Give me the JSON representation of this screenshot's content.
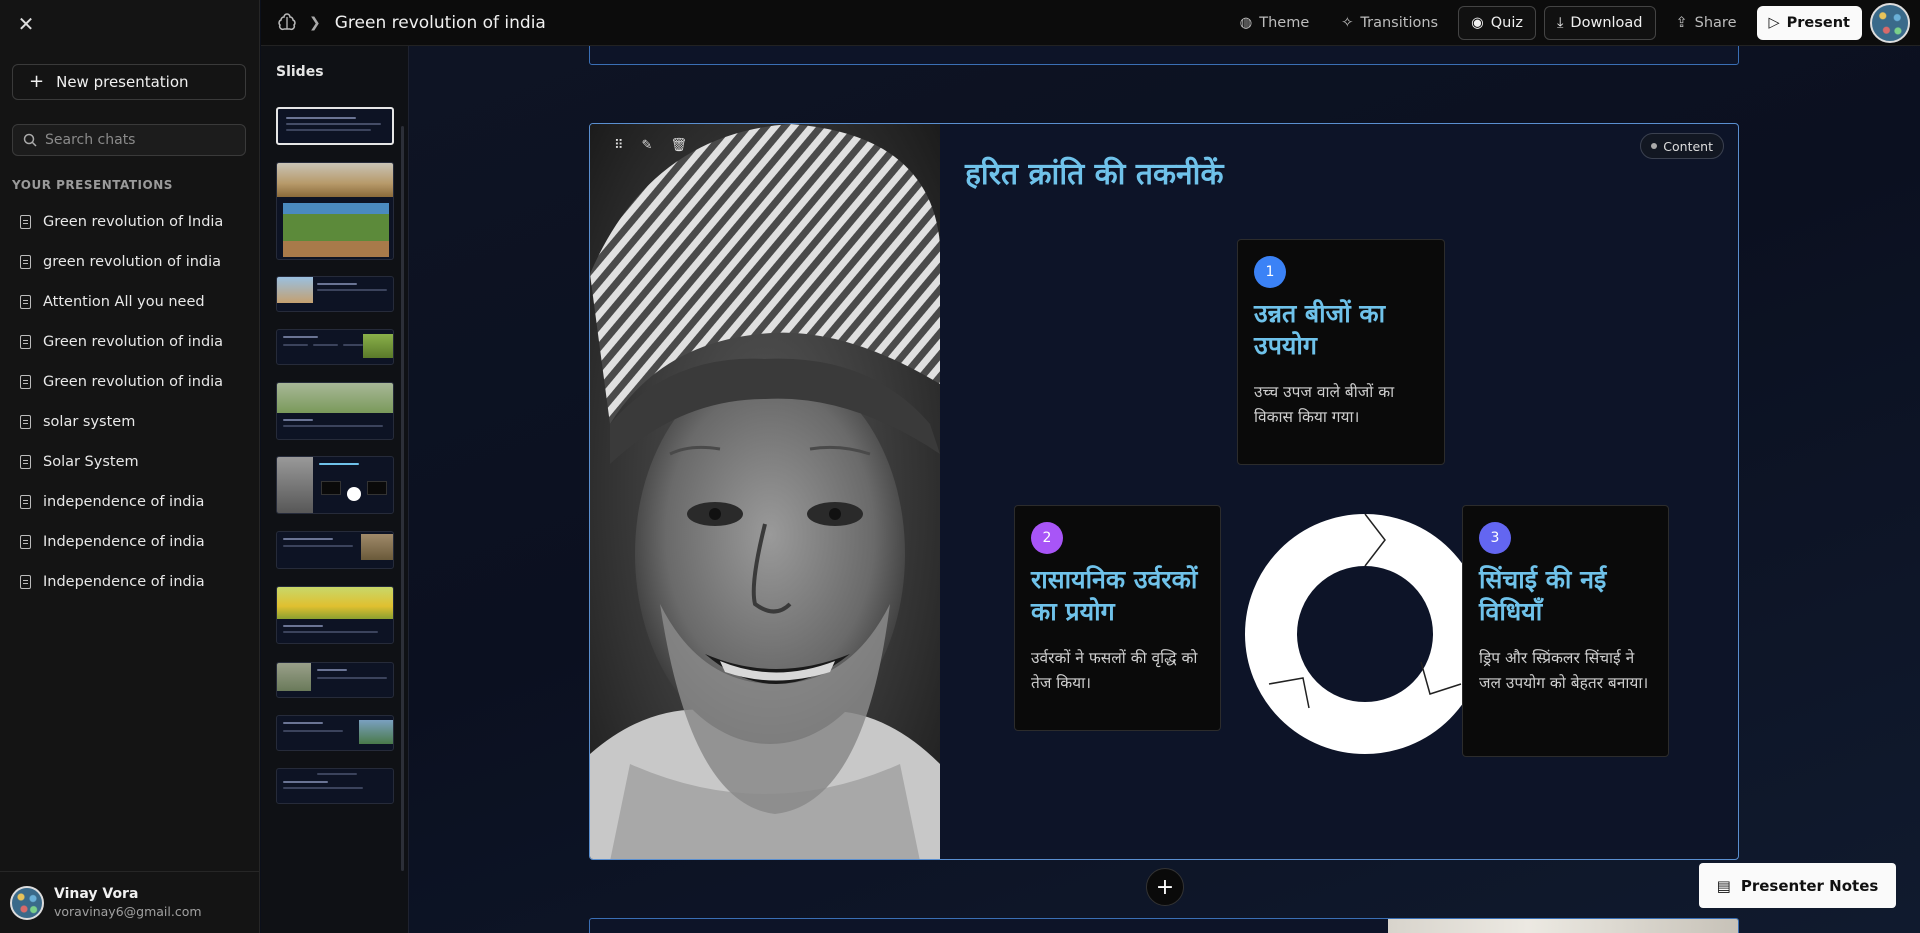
{
  "sidebar": {
    "new_presentation_label": "New presentation",
    "search_placeholder": "Search chats",
    "section_label": "YOUR PRESENTATIONS",
    "presentations": [
      "Green revolution of India",
      "green revolution of india",
      "Attention All you need",
      "Green revolution of india",
      "Green revolution of india",
      "solar system",
      "Solar System",
      "independence of india",
      "Independence of india",
      "Independence of india"
    ],
    "user": {
      "name": "Vinay Vora",
      "email": "voravinay6@gmail.com"
    }
  },
  "topbar": {
    "title": "Green revolution of india",
    "actions": {
      "theme": "Theme",
      "transitions": "Transitions",
      "quiz": "Quiz",
      "download": "Download",
      "share": "Share",
      "present": "Present"
    }
  },
  "slides_panel": {
    "label": "Slides",
    "count": 12,
    "active_index": 0
  },
  "slide": {
    "badge": "Content",
    "heading": "हरित क्रांति की तकनीकें",
    "cards": [
      {
        "num": "1",
        "title": "उन्नत बीजों का उपयोग",
        "desc": "उच्च उपज वाले बीजों का विकास किया गया।",
        "color": "#3b82f6"
      },
      {
        "num": "2",
        "title": "रासायनिक उर्वरकों का प्रयोग",
        "desc": "उर्वरकों ने फसलों की वृद्धि को तेज किया।",
        "color": "#a855f7"
      },
      {
        "num": "3",
        "title": "सिंचाई की नई विधियाँ",
        "desc": "ड्रिप और स्प्रिंकलर सिंचाई ने जल उपयोग को बेहतर बनाया।",
        "color": "#6366f1"
      }
    ]
  },
  "presenter_notes_label": "Presenter Notes",
  "colors": {
    "accent_heading": "#6fc2ea",
    "slide_border": "#5a8fd0",
    "background": "#0b0f1a"
  }
}
